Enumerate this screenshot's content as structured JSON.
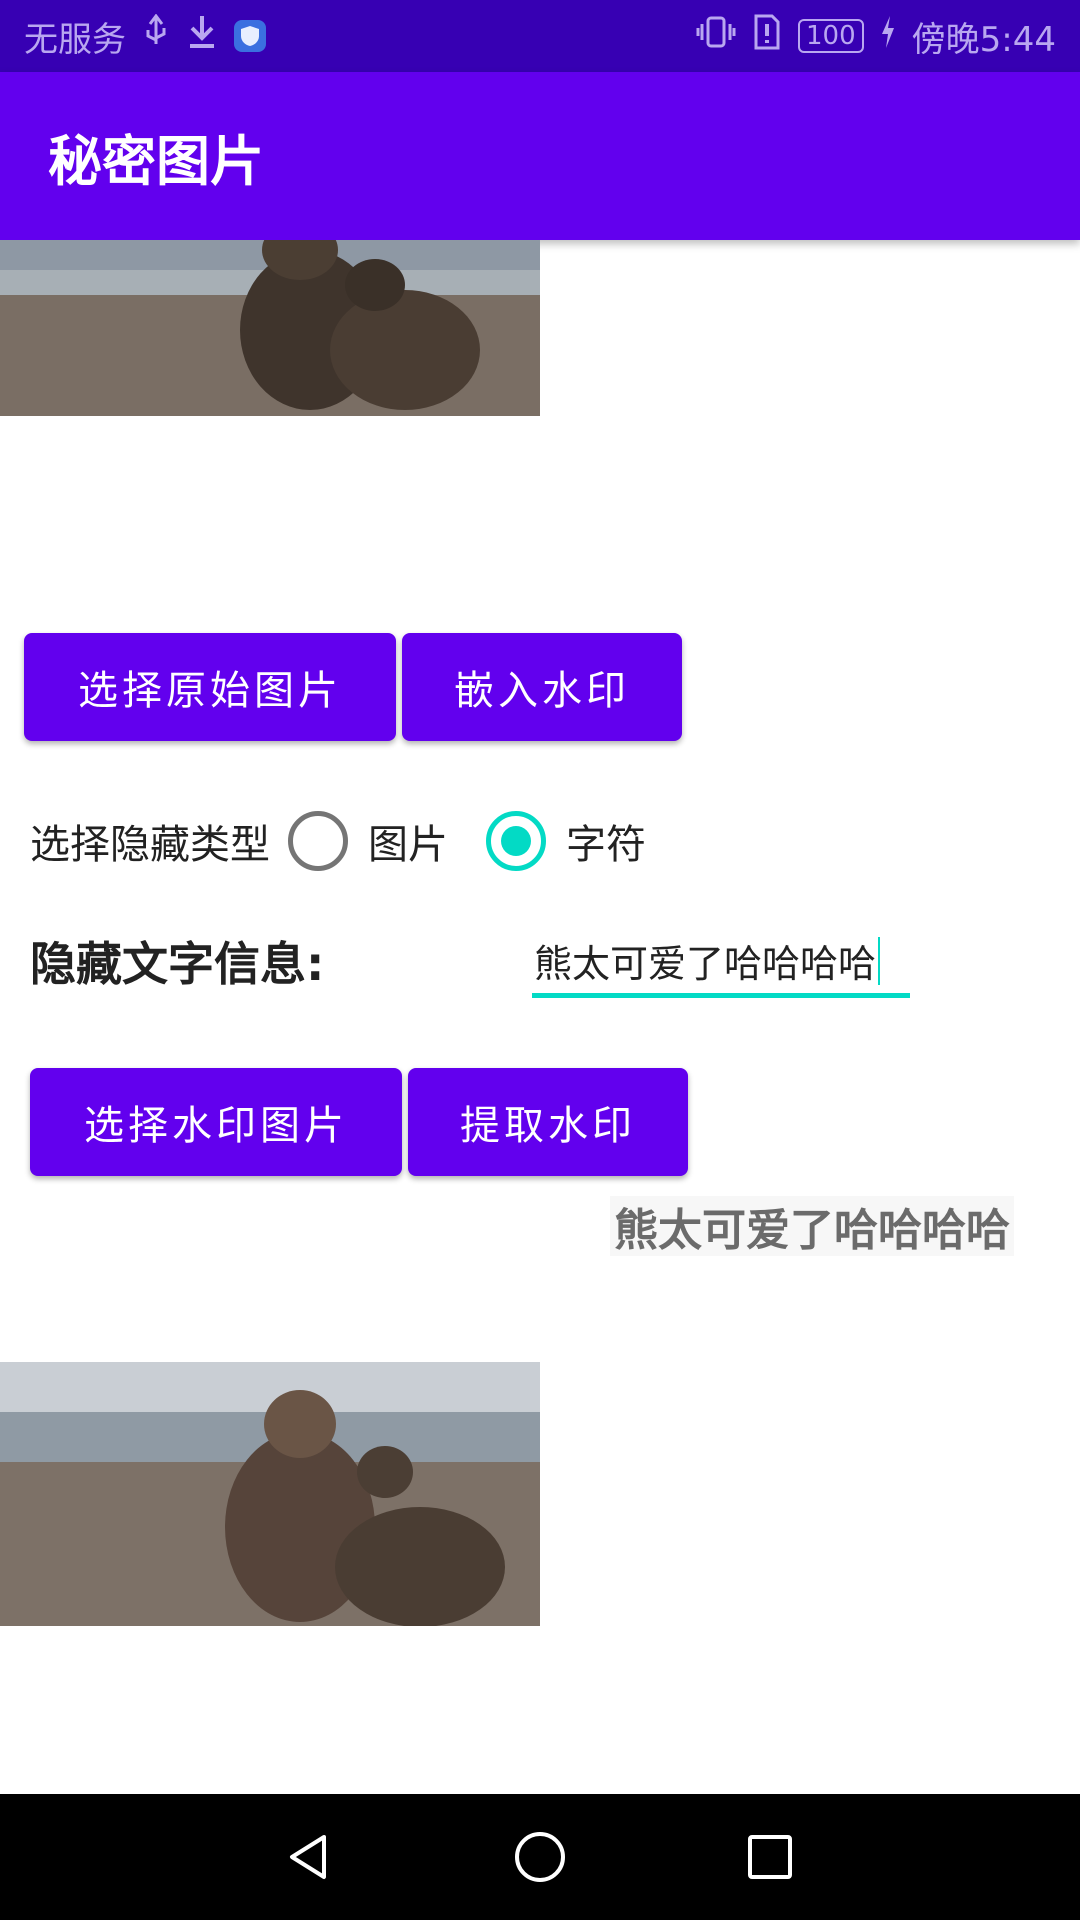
{
  "status_bar": {
    "left_text": "无服务",
    "time_text": "傍晚5:44",
    "battery_text": "100",
    "icons": [
      "usb-icon",
      "download-icon",
      "shield-icon",
      "vibrate-icon",
      "sim-alert-icon",
      "battery-icon",
      "charging-icon"
    ]
  },
  "app_bar": {
    "title": "秘密图片",
    "color": "#6200ee"
  },
  "buttons": {
    "select_original": "选择原始图片",
    "embed_watermark": "嵌入水印",
    "select_watermark": "选择水印图片",
    "extract_watermark": "提取水印"
  },
  "hide_type": {
    "label": "选择隐藏类型",
    "options": [
      "图片",
      "字符"
    ],
    "selected": "字符"
  },
  "hide_text": {
    "label": "隐藏文字信息:",
    "value": "熊太可爱了哈哈哈哈"
  },
  "extracted_text": "熊太可爱了哈哈哈哈",
  "images": {
    "top": "bear-photo",
    "bottom": "bear-photo"
  },
  "nav_bar": {
    "icons": [
      "back-icon",
      "home-icon",
      "recents-icon"
    ]
  },
  "colors": {
    "primary": "#6200ee",
    "primary_dark": "#3700b3",
    "accent": "#03dac5"
  }
}
